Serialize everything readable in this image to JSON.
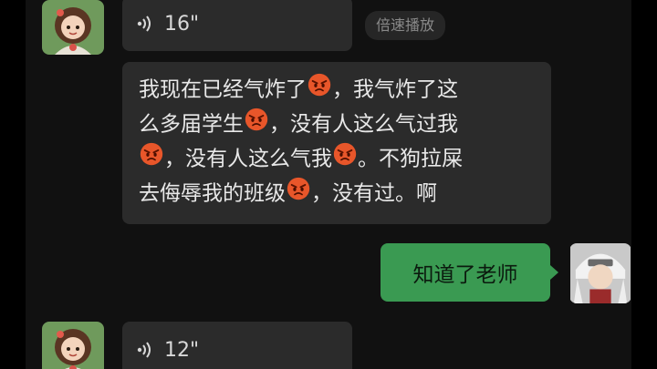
{
  "messages": {
    "voice1": {
      "duration": "16\"",
      "speed_label": "倍速播放"
    },
    "text1": {
      "lines": [
        "我现在已经气炸了",
        "，我气炸了这",
        "么多届学生",
        "，没有人这么气过我",
        "，没有人这么气我",
        "。不狗拉屎",
        "去侮辱我的班级",
        "，没有过。啊"
      ],
      "emoji": "angry-face-emoji"
    },
    "reply": {
      "text": "知道了老师"
    },
    "voice2": {
      "duration": "12\""
    }
  },
  "colors": {
    "background": "#111111",
    "bubble_dark": "#2b2b2b",
    "bubble_green": "#3a9a52",
    "text_light": "#e8e8e8"
  }
}
